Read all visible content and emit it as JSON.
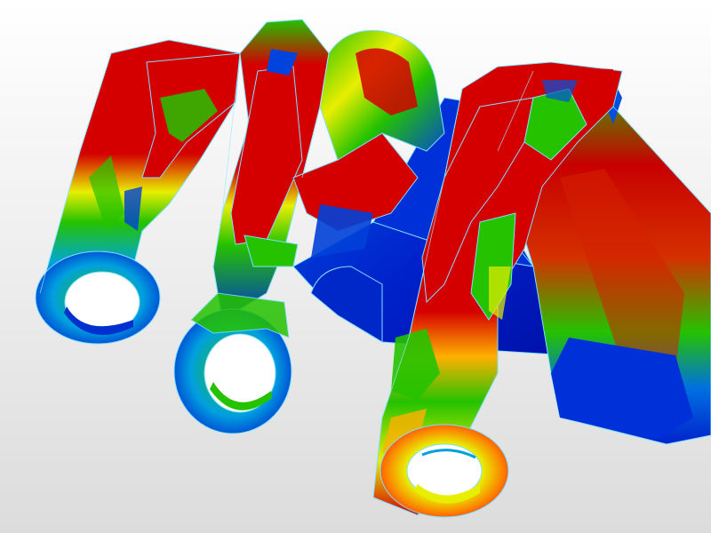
{
  "viewport": {
    "background_top": "#ffffff",
    "background_bottom": "#dcdcdc"
  },
  "colormap": {
    "high": "#d40000",
    "mid_high": "#ff9a00",
    "mid": "#e8ee00",
    "mid_low": "#25c200",
    "low_mid": "#00c8e8",
    "low": "#0022cc",
    "edge": "#7fdfff"
  }
}
